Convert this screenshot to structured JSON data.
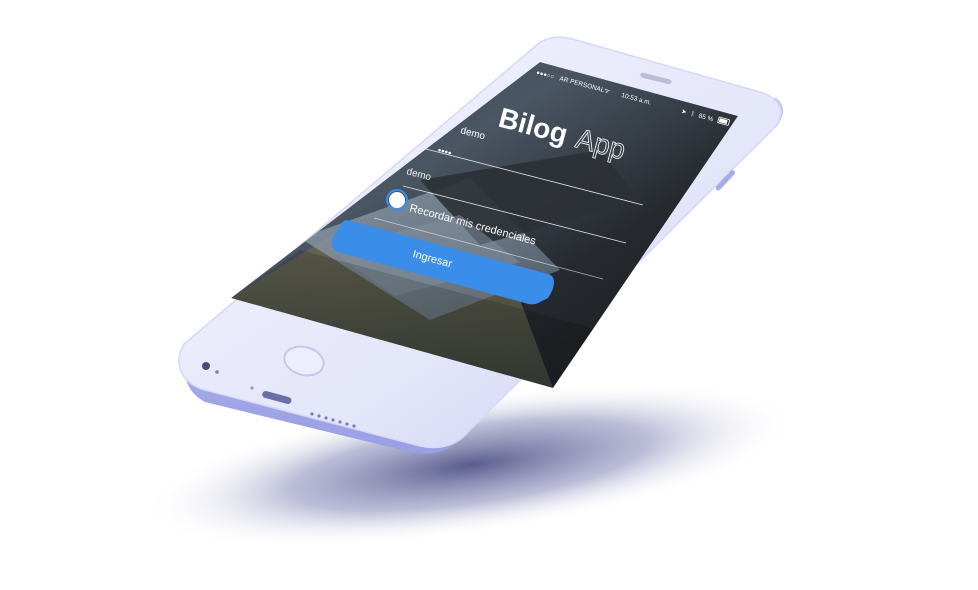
{
  "status_bar": {
    "carrier": "AR PERSONAL",
    "time": "10:53 a.m.",
    "battery": "85 %",
    "icons": [
      "signal-icon",
      "wifi-icon",
      "location-icon",
      "bluetooth-icon",
      "battery-icon"
    ]
  },
  "app": {
    "logo_bold": "Bilog",
    "logo_light": "App"
  },
  "login_form": {
    "username_value": "demo",
    "password_value": "••••",
    "password_placeholder": "demo",
    "remember_label": "Recordar mis credenciales",
    "remember_checked": true,
    "submit_label": "Ingresar"
  },
  "colors": {
    "phone_body": "#eef0fb",
    "phone_edge": "#b9bdf0",
    "accent": "#3a8de8",
    "shadow": "#4a4e86"
  }
}
